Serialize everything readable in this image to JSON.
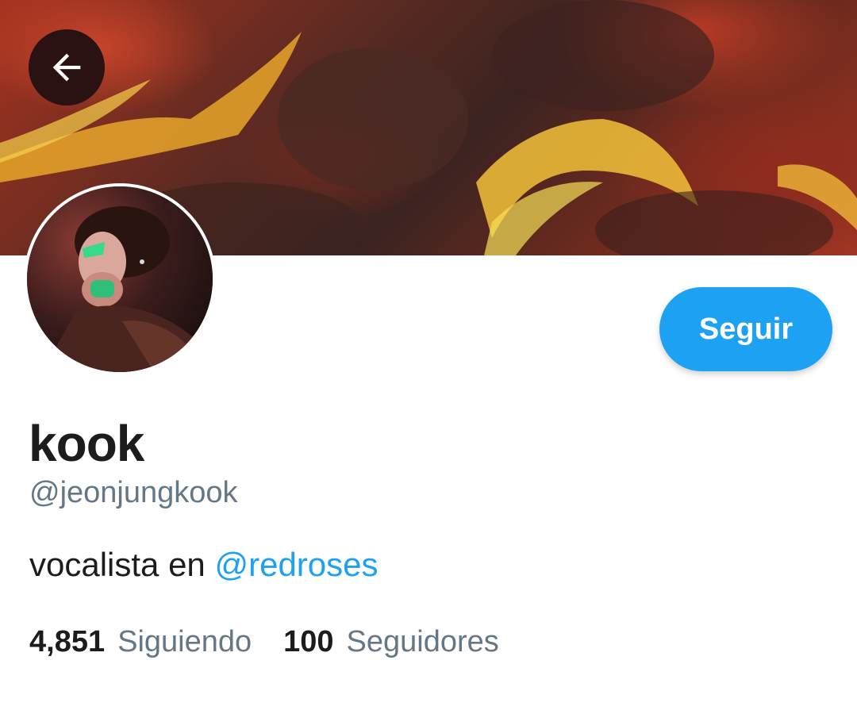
{
  "header": {
    "back_icon": "arrow-left-icon"
  },
  "profile": {
    "display_name": "kook",
    "handle": "@jeonjungkook",
    "bio_prefix": "vocalista en ",
    "bio_mention": "@redroses",
    "follow_label": "Seguir"
  },
  "stats": {
    "following_count": "4,851",
    "following_label": "Siguiendo",
    "followers_count": "100",
    "followers_label": "Seguidores"
  },
  "colors": {
    "accent": "#1da1f2",
    "secondary_text": "#657786",
    "primary_text": "#1c1c1c"
  }
}
